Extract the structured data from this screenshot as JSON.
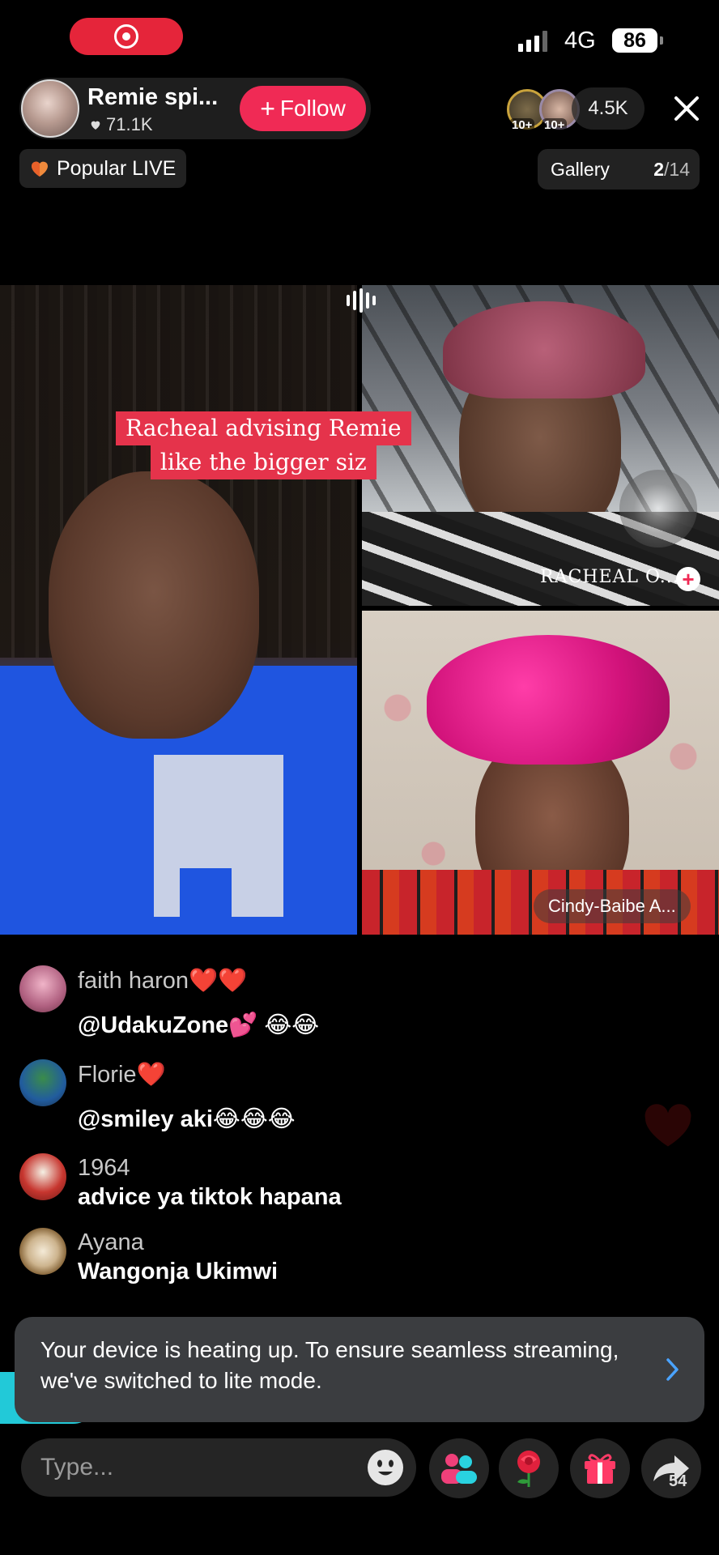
{
  "status_bar": {
    "network": "4G",
    "battery": "86",
    "signal_bars": 3
  },
  "host": {
    "name": "Remie spi...",
    "likes": "71.1K",
    "follow_label": "Follow"
  },
  "viewers": {
    "count": "4.5K",
    "badge_1": "10+",
    "badge_2": "10+"
  },
  "popular": {
    "label": "Popular LIVE"
  },
  "gallery": {
    "label": "Gallery",
    "current": "2",
    "total": "/14"
  },
  "video": {
    "caption_line_1": "Racheal advising Remie",
    "caption_line_2": "like the bigger siz",
    "guest_1_name": "RACHEAL O...",
    "guest_2_name": "Cindy-Baibe A..."
  },
  "comments": [
    {
      "name": "faith haron❤️❤️",
      "text": "@UdakuZone💕  😂😂"
    },
    {
      "name": "Florie❤️",
      "text": "@smiley aki😂😂😂"
    },
    {
      "name": "1964",
      "text": "advice ya tiktok hapana"
    },
    {
      "name": "Ayana",
      "text": "Wangonja Ukimwi"
    }
  ],
  "toast": {
    "message": "Your device is heating up. To ensure seamless streaming, we've switched to lite mode."
  },
  "bottom_bar": {
    "placeholder": "Type...",
    "share_count": "54"
  },
  "colors": {
    "accent": "#f02a55",
    "record": "#e5253a",
    "caption_bg": "#e5334b",
    "toast_bg": "#3b3d40"
  }
}
